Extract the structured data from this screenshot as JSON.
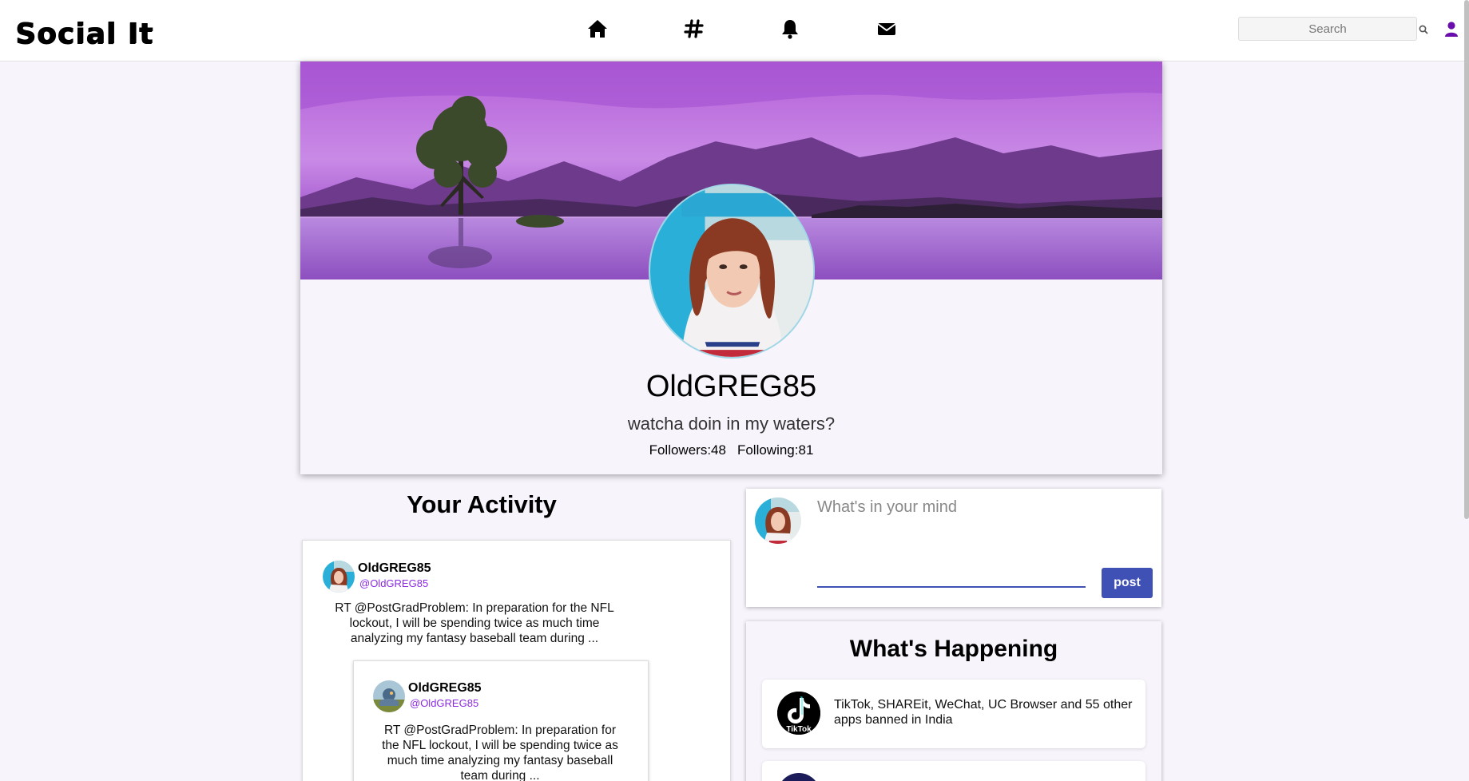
{
  "app": {
    "logo": "Social It"
  },
  "nav": {
    "icons": [
      "home-icon",
      "hashtag-icon",
      "bell-icon",
      "envelope-icon"
    ]
  },
  "search": {
    "placeholder": "Search"
  },
  "profile": {
    "name": "OldGREG85",
    "bio": "watcha doin in my waters?",
    "followers_label": "Followers:48",
    "following_label": "Following:81"
  },
  "activity": {
    "title": "Your Activity",
    "post": {
      "name": "OldGREG85",
      "handle": "@OldGREG85",
      "text": "RT @PostGradProblem: In preparation for the NFL lockout, I will be spending twice as much time analyzing my fantasy baseball team during ..."
    },
    "quote": {
      "name": "OldGREG85",
      "handle": "@OldGREG85",
      "text": "RT @PostGradProblem: In preparation for the NFL lockout, I will be spending twice as much time analyzing my fantasy baseball team during ..."
    }
  },
  "composer": {
    "placeholder": "What's in your mind",
    "button_label": "post"
  },
  "happening": {
    "title": "What's Happening",
    "items": [
      {
        "text": "TikTok, SHAREit, WeChat, UC Browser and 55 other apps banned in India",
        "icon": "tiktok-logo",
        "icon_caption": "TikTok"
      }
    ]
  },
  "colors": {
    "accent": "#3f51b5",
    "handle": "#8a2be2",
    "user_icon": "#6a0dad",
    "page_bg": "#f8f4fc"
  }
}
